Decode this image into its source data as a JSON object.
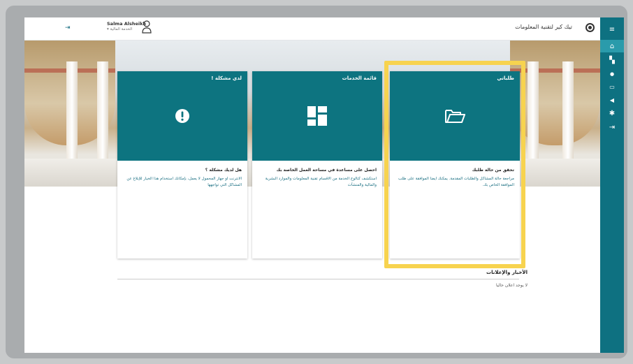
{
  "header": {
    "app_title": "تيك كير لتقنية المعلومات",
    "user_name": "Salma Alsheikh",
    "user_department": "▾ الخدمة المالية"
  },
  "sidebar": {
    "items": [
      {
        "icon": "menu-icon",
        "glyph": "≡"
      },
      {
        "icon": "home-icon",
        "glyph": "⌂"
      },
      {
        "icon": "services-grid-icon",
        "glyph": "▚"
      },
      {
        "icon": "chat-icon",
        "glyph": "●"
      },
      {
        "icon": "folder-icon",
        "glyph": "▭"
      },
      {
        "icon": "megaphone-icon",
        "glyph": "◀"
      },
      {
        "icon": "settings-icon",
        "glyph": "✱"
      },
      {
        "icon": "logout-icon",
        "glyph": "⇥"
      }
    ]
  },
  "cards": [
    {
      "title": "لدي مشكلة !",
      "icon": "exclamation-icon",
      "subtitle": "هل لديك مشكلة ؟",
      "description": "الانترنت او جهاز المحمول لا يعمل، بإمكانك استخدام هذا الخيار للإبلاغ عن المشاكل التي تواجهها"
    },
    {
      "title": "قائمة الخدمات",
      "icon": "services-grid-icon",
      "subtitle": "احصل على مساعدة في مساحة العمل الخاصة بك",
      "description": "استكشف كتالوج الخدمة من الاقسام تقنية المعلومات والموارد البشرية والمالية والمنشآت"
    },
    {
      "title": "طلباتي",
      "icon": "folder-open-icon",
      "subtitle": "تحقق من حالة طلبك",
      "description": "مراجعة حالة المشاكل والطلبات المقدمة. يمكنك ايضا الموافقة على طلب الموافقة الخاص بك."
    }
  ],
  "news": {
    "title": "الأخبار والإعلانات",
    "empty_text": "لا يوجد اعلان حاليا"
  },
  "colors": {
    "primary": "#0d7480",
    "sidebar": "#0e7181",
    "highlight": "#f7d34f"
  }
}
